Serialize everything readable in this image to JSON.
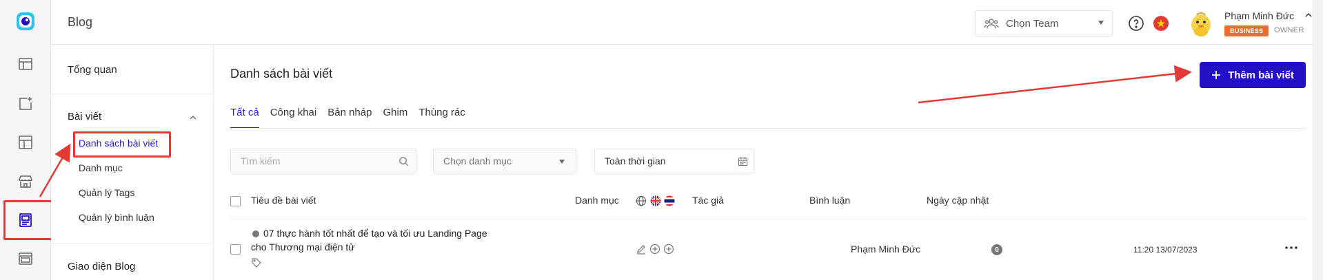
{
  "app": {
    "title": "Blog"
  },
  "header": {
    "team_select_placeholder": "Chọn Team",
    "user_name": "Phạm Minh Đức",
    "plan_badge": "BUSINESS",
    "role": "OWNER",
    "flag": "vietnam-flag-icon"
  },
  "rail": {
    "icons": [
      "app-logo-icon",
      "dashboard-icon",
      "add-page-icon",
      "layout-icon",
      "store-icon",
      "blog-icon",
      "browser-icon"
    ],
    "active": "blog-icon"
  },
  "subsidebar": {
    "overview": "Tổng quan",
    "group_label": "Bài viết",
    "items": [
      {
        "label": "Danh sách bài viết",
        "active": true
      },
      {
        "label": "Danh mục",
        "active": false
      },
      {
        "label": "Quản lý Tags",
        "active": false
      },
      {
        "label": "Quản lý bình luận",
        "active": false
      }
    ],
    "blog_ui": "Giao diện Blog"
  },
  "main": {
    "page_title": "Danh sách bài viết",
    "add_button": "Thêm bài viết",
    "tabs": [
      {
        "label": "Tất cả",
        "active": true
      },
      {
        "label": "Công khai",
        "active": false
      },
      {
        "label": "Bản nháp",
        "active": false
      },
      {
        "label": "Ghim",
        "active": false
      },
      {
        "label": "Thùng rác",
        "active": false
      }
    ],
    "filters": {
      "search_placeholder": "Tìm kiếm",
      "category_placeholder": "Chọn danh mục",
      "time_value": "Toàn thời gian"
    },
    "table": {
      "columns": [
        "Tiêu đề bài viết",
        "Danh mục",
        "Tác giả",
        "Bình luận",
        "Ngày cập nhật"
      ],
      "language_icons": [
        "globe-icon",
        "uk-flag-icon",
        "thailand-flag-icon"
      ],
      "rows": [
        {
          "title_line1": "07 thực hành tốt nhất để tạo và tối ưu Landing Page",
          "title_line2": "cho Thương mại điện tử",
          "category": "",
          "author": "Phạm Minh Đức",
          "comments": "0",
          "updated": "11:20 13/07/2023"
        }
      ]
    }
  },
  "colors": {
    "accent": "#2410c4",
    "active_text": "#2d1bd6",
    "annotation": "#e53935",
    "badge": "#f26d21"
  }
}
